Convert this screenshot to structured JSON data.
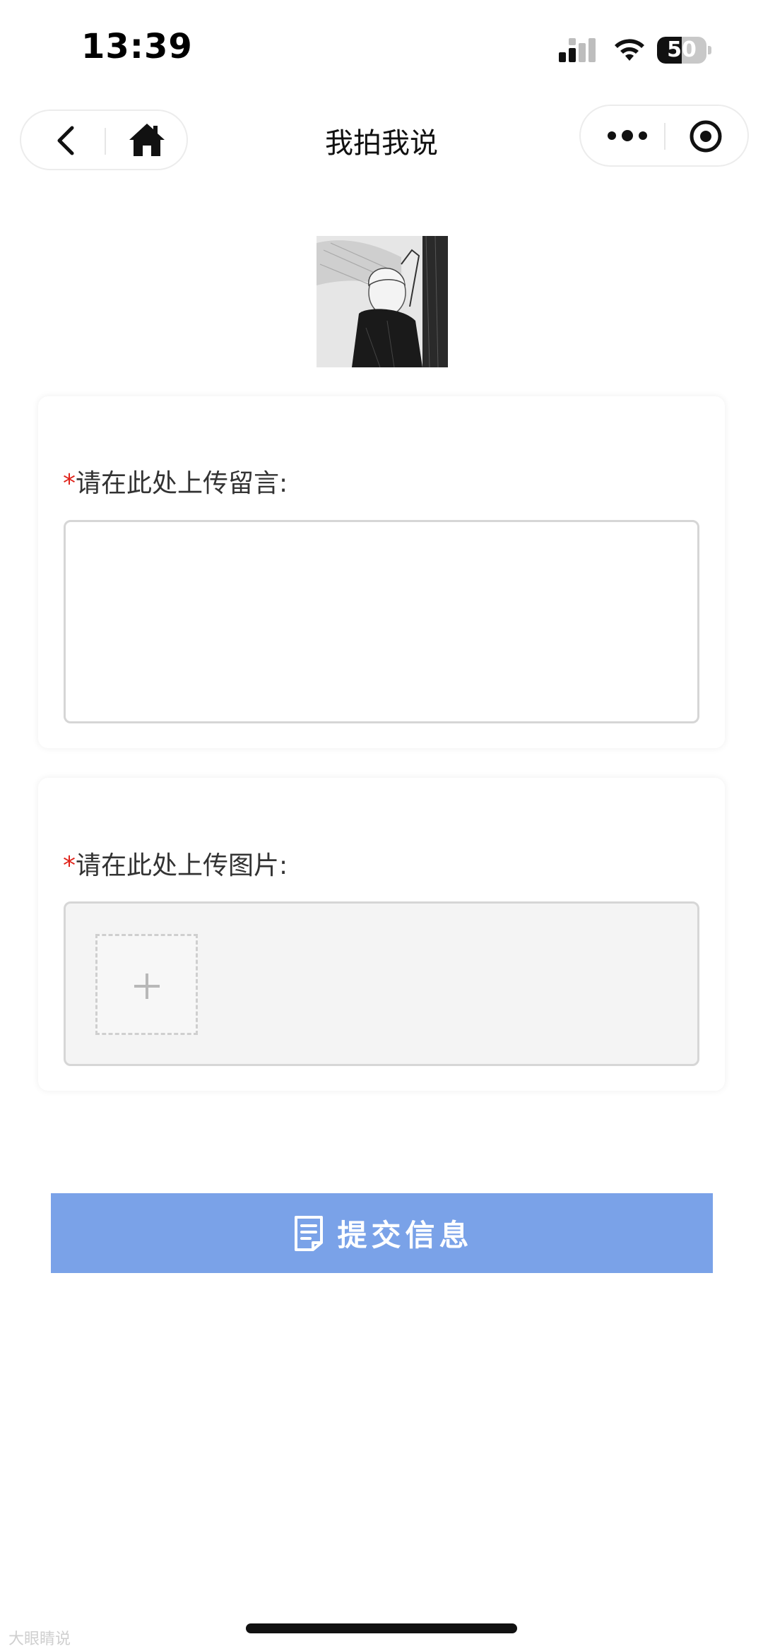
{
  "status_bar": {
    "time": "13:39",
    "battery": "50",
    "battery_level": 0.5,
    "signal_icon": "cellular-signal-icon",
    "wifi_icon": "wifi-icon"
  },
  "nav": {
    "title": "我拍我说",
    "back_icon": "chevron-left-icon",
    "home_icon": "home-icon",
    "more_icon": "more-dots-icon",
    "close_icon": "target-circle-icon"
  },
  "form": {
    "message": {
      "required_mark": "*",
      "label": "请在此处上传留言:",
      "value": "",
      "placeholder": ""
    },
    "image": {
      "required_mark": "*",
      "label": "请在此处上传图片:",
      "add_icon": "plus-icon"
    },
    "submit": {
      "label": "提交信息",
      "icon": "document-icon"
    }
  },
  "watermark": {
    "text": "大眼睛说"
  },
  "colors": {
    "accent": "#7aa2e8",
    "required": "#e0241b",
    "card_bg": "#ffffff",
    "upload_bg": "#f4f4f4"
  }
}
